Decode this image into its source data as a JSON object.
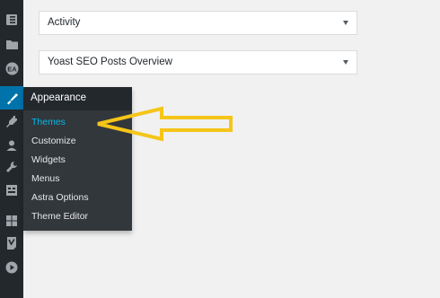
{
  "sidebar": {
    "icons": [
      {
        "name": "dashboard-icon"
      },
      {
        "name": "folder-icon"
      },
      {
        "name": "ea-icon",
        "text": "EA"
      },
      {
        "name": "appearance-icon",
        "active": true
      },
      {
        "name": "plugins-icon"
      },
      {
        "name": "users-icon"
      },
      {
        "name": "tools-icon"
      },
      {
        "name": "settings-icon"
      },
      {
        "name": "grid-icon"
      },
      {
        "name": "yoast-icon"
      },
      {
        "name": "play-icon"
      }
    ]
  },
  "widgets": [
    {
      "title": "Activity"
    },
    {
      "title": "Yoast SEO Posts Overview"
    }
  ],
  "flyout": {
    "heading": "Appearance",
    "items": [
      {
        "label": "Themes",
        "current": true
      },
      {
        "label": "Customize"
      },
      {
        "label": "Widgets"
      },
      {
        "label": "Menus"
      },
      {
        "label": "Astra Options"
      },
      {
        "label": "Theme Editor"
      }
    ]
  },
  "colors": {
    "sidebar_bg": "#23282d",
    "flyout_bg": "#32373c",
    "active_blue": "#0073aa",
    "current_link": "#00b9eb",
    "arrow": "#f5c518"
  }
}
